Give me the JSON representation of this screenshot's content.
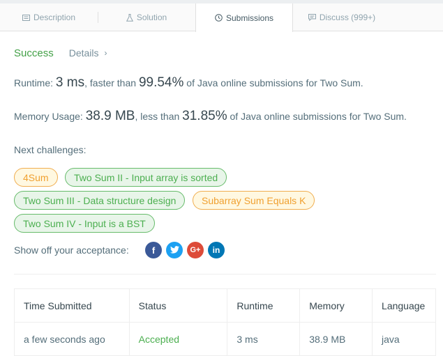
{
  "tabs": [
    {
      "label": "Description",
      "icon": "document-icon"
    },
    {
      "label": "Solution",
      "icon": "flask-icon"
    },
    {
      "label": "Submissions",
      "icon": "clock-icon"
    },
    {
      "label": "Discuss (999+)",
      "icon": "chat-icon"
    }
  ],
  "result": {
    "status": "Success",
    "details_label": "Details",
    "details_chevron": "›"
  },
  "runtime": {
    "label": "Runtime: ",
    "value": "3 ms",
    "comparison": ", faster than ",
    "percent": "99.54%",
    "suffix": " of Java online submissions for Two Sum."
  },
  "memory": {
    "label": "Memory Usage: ",
    "value": "38.9 MB",
    "comparison": ", less than ",
    "percent": "31.85%",
    "suffix": " of Java online submissions for Two Sum."
  },
  "next_challenges": {
    "label": "Next challenges:",
    "items": [
      {
        "label": "4Sum",
        "difficulty": "medium"
      },
      {
        "label": "Two Sum II - Input array is sorted",
        "difficulty": "easy"
      },
      {
        "label": "Two Sum III - Data structure design",
        "difficulty": "easy"
      },
      {
        "label": "Subarray Sum Equals K",
        "difficulty": "medium"
      },
      {
        "label": "Two Sum IV - Input is a BST",
        "difficulty": "easy"
      }
    ]
  },
  "share": {
    "label": "Show off your acceptance:",
    "icons": {
      "facebook": "f",
      "twitter": "t",
      "google_plus": "G+",
      "linkedin": "in"
    }
  },
  "table": {
    "headers": [
      "Time Submitted",
      "Status",
      "Runtime",
      "Memory",
      "Language"
    ],
    "rows": [
      [
        "a few seconds ago",
        "Accepted",
        "3 ms",
        "38.9 MB",
        "java"
      ]
    ]
  },
  "colors": {
    "success": "#4caf50",
    "easy_chip_border": "#66bb6a",
    "medium_chip_border": "#f0ad4e"
  }
}
